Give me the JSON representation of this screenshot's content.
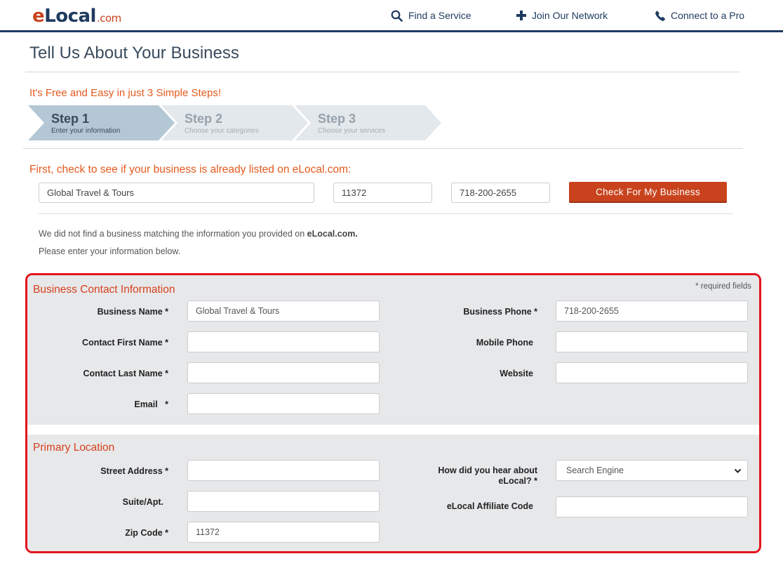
{
  "header": {
    "logo": {
      "e": "e",
      "local": "Local",
      "com": ".com"
    },
    "nav": [
      {
        "label": "Find a Service",
        "icon": "search-icon"
      },
      {
        "label": "Join Our Network",
        "icon": "plus-icon"
      },
      {
        "label": "Connect to a Pro",
        "icon": "phone-icon"
      }
    ]
  },
  "page": {
    "title": "Tell Us About Your Business",
    "steps_intro": "It's Free and Easy in just 3 Simple Steps!"
  },
  "steps": [
    {
      "title": "Step 1",
      "subtitle": "Enter your information",
      "active": true
    },
    {
      "title": "Step 2",
      "subtitle": "Choose your categories",
      "active": false
    },
    {
      "title": "Step 3",
      "subtitle": "Choose your services",
      "active": false
    }
  ],
  "check": {
    "heading": "First, check to see if your business is already listed on eLocal.com:",
    "business_name": "Global Travel & Tours",
    "zip": "11372",
    "phone": "718-200-2655",
    "button_label": "Check For My Business"
  },
  "notice": {
    "line1_prefix": "We did not find a business matching the information you provided on ",
    "line1_brand": "eLocal.com.",
    "line2": "Please enter your information below."
  },
  "contact": {
    "title": "Business Contact Information",
    "required_note": "* required fields",
    "business_name_label": "Business Name *",
    "business_name_value": "Global Travel & Tours",
    "first_name_label": "Contact First Name *",
    "first_name_value": "",
    "last_name_label": "Contact Last Name *",
    "last_name_value": "",
    "email_label": "Email   *",
    "email_value": "",
    "business_phone_label": "Business Phone *",
    "business_phone_value": "718-200-2655",
    "mobile_phone_label": "Mobile Phone",
    "mobile_phone_value": "",
    "website_label": "Website",
    "website_value": ""
  },
  "location": {
    "title": "Primary Location",
    "street_label": "Street Address *",
    "street_value": "",
    "suite_label": "Suite/Apt.",
    "suite_value": "",
    "zip_label": "Zip Code *",
    "zip_value": "11372",
    "hear_label_line1": "How did you hear about",
    "hear_label_line2": "eLocal? *",
    "hear_value": "Search Engine",
    "affiliate_label": "eLocal Affiliate Code",
    "affiliate_value": ""
  },
  "colors": {
    "brand_orange": "#c8431d",
    "brand_navy": "#1e3a5f",
    "highlight_red": "#e3141c"
  }
}
